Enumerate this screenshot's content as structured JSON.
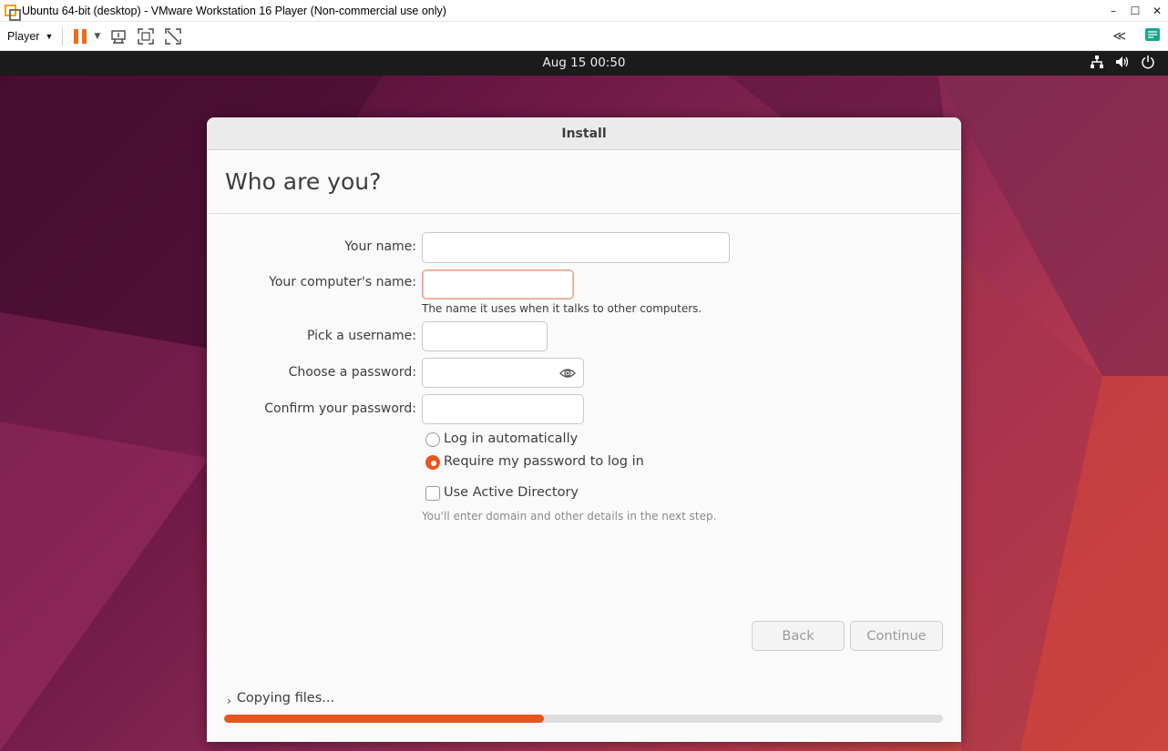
{
  "vm_window": {
    "title": "Ubuntu 64-bit (desktop) - VMware Workstation 16 Player (Non-commercial use only)",
    "controls": {
      "minimize": "–",
      "maximize": "☐",
      "close": "✕"
    }
  },
  "vm_toolbar": {
    "player_menu_label": "Player",
    "icons": [
      "pause-icon",
      "send-ctrl-alt-del-icon",
      "fullscreen-icon",
      "unity-icon",
      "collapse-icon",
      "notes-icon"
    ],
    "collapse_glyph": "≪"
  },
  "topbar": {
    "clock": "Aug 15  00:50",
    "tray_icons": [
      "network-icon",
      "volume-icon",
      "power-icon"
    ]
  },
  "installer": {
    "window_title": "Install",
    "heading": "Who are you?",
    "fields": {
      "your_name": {
        "label": "Your name:",
        "value": ""
      },
      "computer_name": {
        "label": "Your computer's name:",
        "value": "",
        "hint": "The name it uses when it talks to other computers."
      },
      "username": {
        "label": "Pick a username:",
        "value": ""
      },
      "password": {
        "label": "Choose a password:",
        "value": ""
      },
      "confirm_password": {
        "label": "Confirm your password:",
        "value": ""
      }
    },
    "login_options": {
      "auto_login": {
        "label": "Log in automatically",
        "selected": false
      },
      "require_password": {
        "label": "Require my password to log in",
        "selected": true
      }
    },
    "active_directory": {
      "label": "Use Active Directory",
      "checked": false,
      "hint": "You'll enter domain and other details in the next step."
    },
    "buttons": {
      "back": "Back",
      "continue": "Continue"
    },
    "progress": {
      "label": "Copying files...",
      "fraction": 0.445
    }
  },
  "colors": {
    "accent": "#e95420",
    "desktop_dark": "#3f0b2c",
    "desktop_warm": "#d4523a"
  }
}
